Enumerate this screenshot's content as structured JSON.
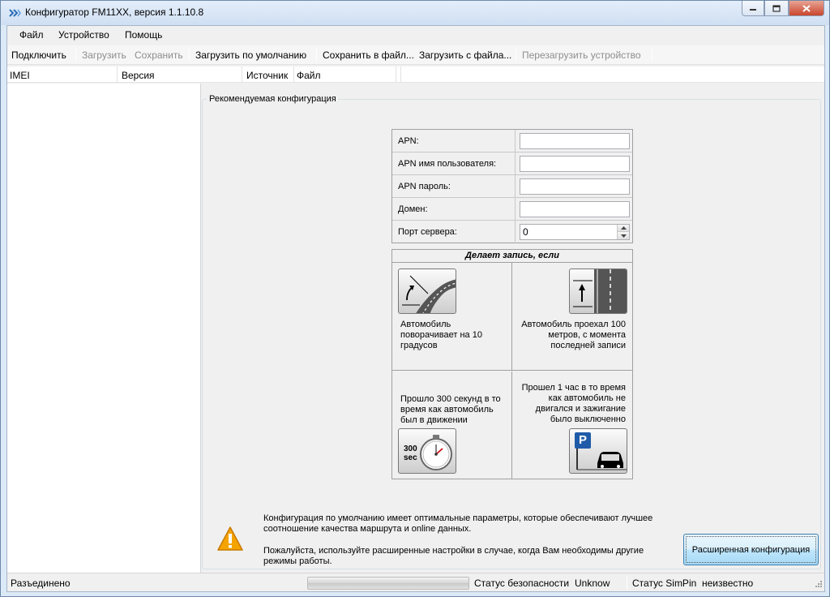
{
  "window": {
    "title": "Конфигуратор FM11XX, версия 1.1.10.8"
  },
  "menu": {
    "items": [
      "Файл",
      "Устройство",
      "Помощь"
    ]
  },
  "toolbar": {
    "connect": "Подключить",
    "load": "Загрузить",
    "save": "Сохранить",
    "load_default": "Загрузить по умолчанию",
    "save_to_file": "Сохранить в файл...",
    "load_from_file": "Загрузить с файла...",
    "reboot": "Перезагрузить устройство"
  },
  "device_list": {
    "columns": [
      "IMEI",
      "Версия",
      "Источник",
      "Файл"
    ]
  },
  "config": {
    "group_title": "Рекомендуемая конфигурация",
    "fields": [
      {
        "label": "APN:",
        "value": ""
      },
      {
        "label": "APN имя пользователя:",
        "value": ""
      },
      {
        "label": "APN пароль:",
        "value": ""
      },
      {
        "label": "Домен:",
        "value": ""
      },
      {
        "label": "Порт сервера:",
        "value": "0"
      }
    ],
    "record_title": "Делает запись, если",
    "conditions": {
      "turn": "Автомобиль поворачивает на 10 градусов",
      "distance": "Автомобиль проехал 100 метров, с момента последней записи",
      "time": "Прошло 300 секунд в то время как автомобиль был в движении",
      "stop": "Прошел 1 час в то время как автомобиль не двигался и зажигание было выключенно"
    },
    "timer_label_top": "300",
    "timer_label_bottom": "sec",
    "parking_letter": "P"
  },
  "info": {
    "line1": "Конфигурация по умолчанию имеет оптимальные параметры, которые обеспечивают лучшее соотношение качества маршрута и online данных.",
    "line2": "Пожалуйста, используйте расширенные настройки в случае, когда Вам необходимы другие режимы работы.",
    "advanced_button": "Расширенная конфигурация"
  },
  "status": {
    "connection": "Разъединено",
    "progress": 0,
    "security_label": "Статус безопасности",
    "security_value": "Unknow",
    "simpin_label": "Статус SimPin",
    "simpin_value": "неизвестно"
  },
  "colors": {
    "accent": "#3c7fb1",
    "warning": "#f5a300"
  }
}
